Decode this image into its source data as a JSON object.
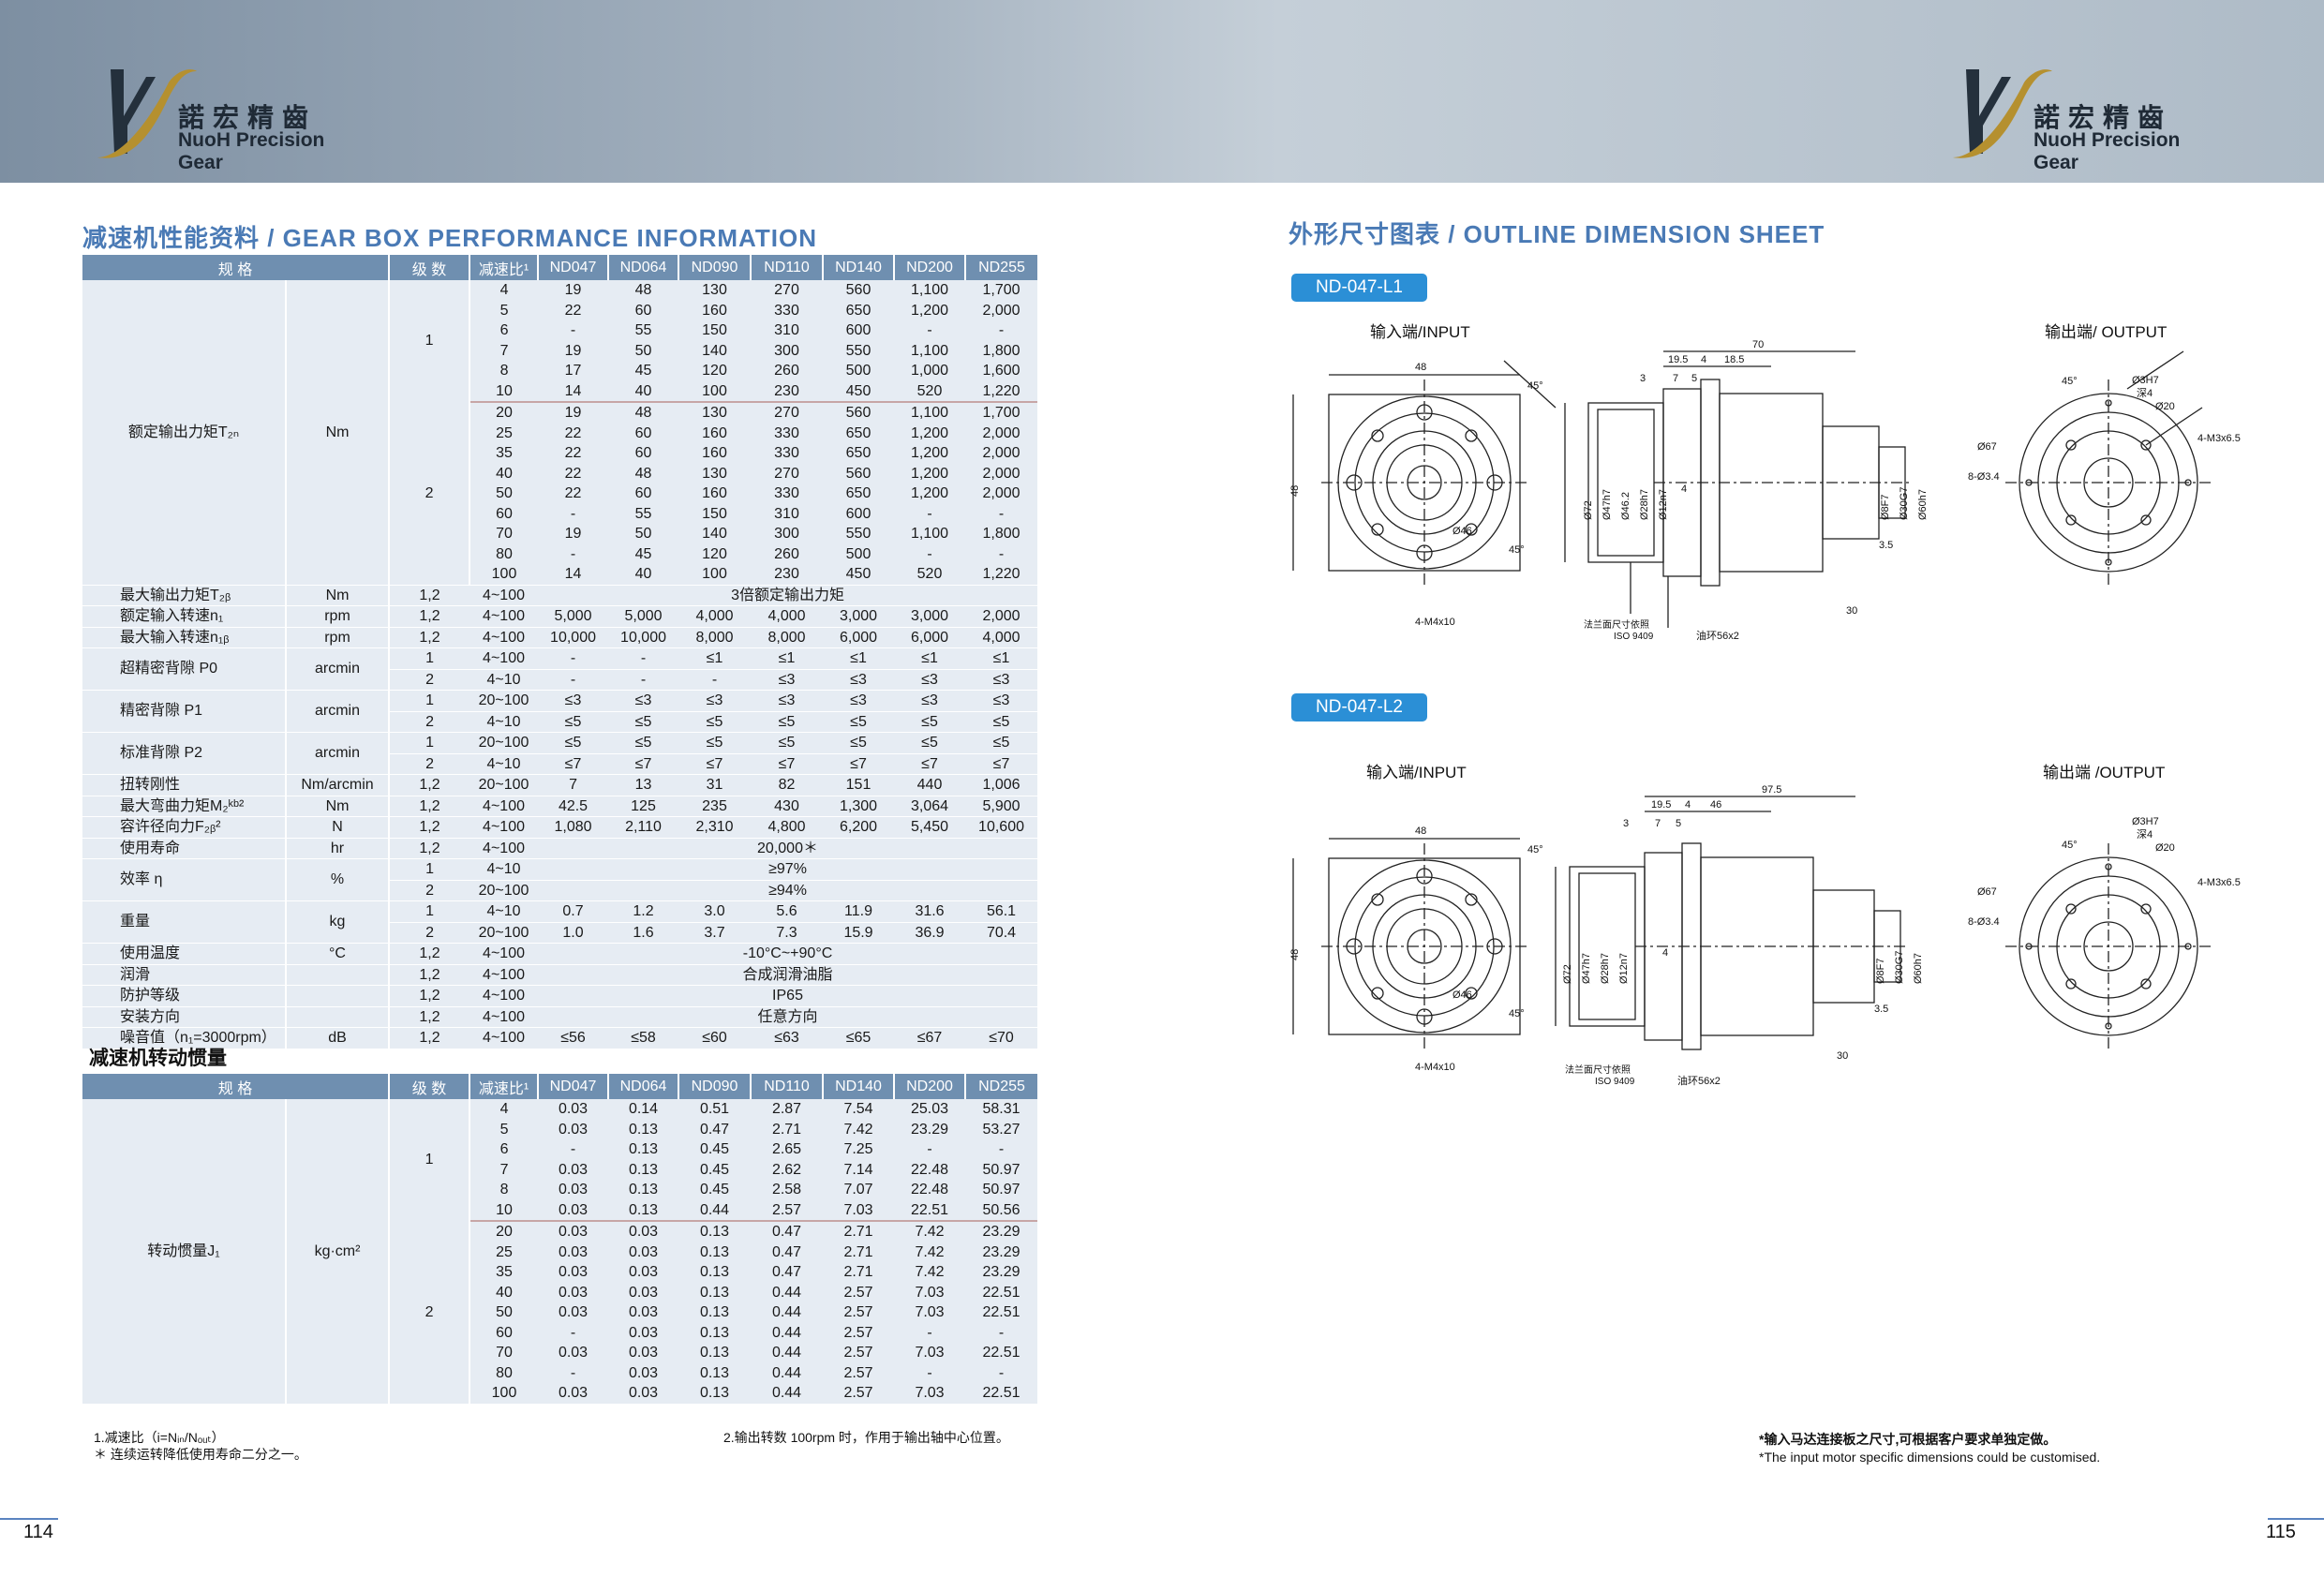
{
  "brand": {
    "cn": "諾宏精齒",
    "en": "NuoH Precision Gear"
  },
  "left": {
    "title": "减速机性能资料 / GEAR BOX PERFORMANCE INFORMATION",
    "headers": [
      "规 格",
      "级 数",
      "减速比¹",
      "ND047",
      "ND064",
      "ND090",
      "ND110",
      "ND140",
      "ND200",
      "ND255"
    ],
    "torque": {
      "label": "额定输出力矩T₂ₙ",
      "unit": "Nm",
      "stage1": {
        "stage": "1",
        "rows": [
          [
            "4",
            "19",
            "48",
            "130",
            "270",
            "560",
            "1,100",
            "1,700"
          ],
          [
            "5",
            "22",
            "60",
            "160",
            "330",
            "650",
            "1,200",
            "2,000"
          ],
          [
            "6",
            "-",
            "55",
            "150",
            "310",
            "600",
            "-",
            "-"
          ],
          [
            "7",
            "19",
            "50",
            "140",
            "300",
            "550",
            "1,100",
            "1,800"
          ],
          [
            "8",
            "17",
            "45",
            "120",
            "260",
            "500",
            "1,000",
            "1,600"
          ],
          [
            "10",
            "14",
            "40",
            "100",
            "230",
            "450",
            "520",
            "1,220"
          ]
        ]
      },
      "stage2": {
        "stage": "2",
        "rows": [
          [
            "20",
            "19",
            "48",
            "130",
            "270",
            "560",
            "1,100",
            "1,700"
          ],
          [
            "25",
            "22",
            "60",
            "160",
            "330",
            "650",
            "1,200",
            "2,000"
          ],
          [
            "35",
            "22",
            "60",
            "160",
            "330",
            "650",
            "1,200",
            "2,000"
          ],
          [
            "40",
            "22",
            "48",
            "130",
            "270",
            "560",
            "1,200",
            "2,000"
          ],
          [
            "50",
            "22",
            "60",
            "160",
            "330",
            "650",
            "1,200",
            "2,000"
          ],
          [
            "60",
            "-",
            "55",
            "150",
            "310",
            "600",
            "-",
            "-"
          ],
          [
            "70",
            "19",
            "50",
            "140",
            "300",
            "550",
            "1,100",
            "1,800"
          ],
          [
            "80",
            "-",
            "45",
            "120",
            "260",
            "500",
            "-",
            "-"
          ],
          [
            "100",
            "14",
            "40",
            "100",
            "230",
            "450",
            "520",
            "1,220"
          ]
        ]
      }
    },
    "spec_rows": [
      {
        "label": "最大输出力矩T₂ᵦ",
        "unit": "Nm",
        "stage": "1,2",
        "ratio": "4~100",
        "span": "3倍额定输出力矩"
      },
      {
        "label": "额定输入转速n₁",
        "unit": "rpm",
        "stage": "1,2",
        "ratio": "4~100",
        "values": [
          "5,000",
          "5,000",
          "4,000",
          "4,000",
          "3,000",
          "3,000",
          "2,000"
        ]
      },
      {
        "label": "最大输入转速n₁ᵦ",
        "unit": "rpm",
        "stage": "1,2",
        "ratio": "4~100",
        "values": [
          "10,000",
          "10,000",
          "8,000",
          "8,000",
          "6,000",
          "6,000",
          "4,000"
        ]
      }
    ],
    "backlash": [
      {
        "label": "超精密背隙 P0",
        "unit": "arcmin",
        "rows": [
          {
            "stage": "1",
            "ratio": "4~100",
            "values": [
              "-",
              "-",
              "≤1",
              "≤1",
              "≤1",
              "≤1",
              "≤1"
            ]
          },
          {
            "stage": "2",
            "ratio": "4~10",
            "values": [
              "-",
              "-",
              "-",
              "≤3",
              "≤3",
              "≤3",
              "≤3"
            ]
          }
        ]
      },
      {
        "label": "精密背隙 P1",
        "unit": "arcmin",
        "rows": [
          {
            "stage": "1",
            "ratio": "20~100",
            "values": [
              "≤3",
              "≤3",
              "≤3",
              "≤3",
              "≤3",
              "≤3",
              "≤3"
            ]
          },
          {
            "stage": "2",
            "ratio": "4~10",
            "values": [
              "≤5",
              "≤5",
              "≤5",
              "≤5",
              "≤5",
              "≤5",
              "≤5"
            ]
          }
        ]
      },
      {
        "label": "标准背隙 P2",
        "unit": "arcmin",
        "rows": [
          {
            "stage": "1",
            "ratio": "20~100",
            "values": [
              "≤5",
              "≤5",
              "≤5",
              "≤5",
              "≤5",
              "≤5",
              "≤5"
            ]
          },
          {
            "stage": "2",
            "ratio": "4~10",
            "values": [
              "≤7",
              "≤7",
              "≤7",
              "≤7",
              "≤7",
              "≤7",
              "≤7"
            ]
          }
        ]
      }
    ],
    "spec_rows2": [
      {
        "label": "扭转刚性",
        "unit": "Nm/arcmin",
        "stage": "1,2",
        "ratio": "20~100",
        "values": [
          "7",
          "13",
          "31",
          "82",
          "151",
          "440",
          "1,006"
        ]
      },
      {
        "label": "最大弯曲力矩M₂ᵏᵇ²",
        "unit": "Nm",
        "stage": "1,2",
        "ratio": "4~100",
        "values": [
          "42.5",
          "125",
          "235",
          "430",
          "1,300",
          "3,064",
          "5,900"
        ]
      },
      {
        "label": "容许径向力F₂ᵦ²",
        "unit": "N",
        "stage": "1,2",
        "ratio": "4~100",
        "values": [
          "1,080",
          "2,110",
          "2,310",
          "4,800",
          "6,200",
          "5,450",
          "10,600"
        ]
      },
      {
        "label": "使用寿命",
        "unit": "hr",
        "stage": "1,2",
        "ratio": "4~100",
        "span": "20,000＊"
      }
    ],
    "efficiency": {
      "label": "效率 η",
      "unit": "%",
      "rows": [
        {
          "stage": "1",
          "ratio": "4~10",
          "span": "≥97%"
        },
        {
          "stage": "2",
          "ratio": "20~100",
          "span": "≥94%"
        }
      ]
    },
    "weight": {
      "label": "重量",
      "unit": "kg",
      "rows": [
        {
          "stage": "1",
          "ratio": "4~10",
          "values": [
            "0.7",
            "1.2",
            "3.0",
            "5.6",
            "11.9",
            "31.6",
            "56.1"
          ]
        },
        {
          "stage": "2",
          "ratio": "20~100",
          "values": [
            "1.0",
            "1.6",
            "3.7",
            "7.3",
            "15.9",
            "36.9",
            "70.4"
          ]
        }
      ]
    },
    "spec_rows3": [
      {
        "label": "使用温度",
        "unit": "°C",
        "stage": "1,2",
        "ratio": "4~100",
        "span": "-10°C~+90°C"
      },
      {
        "label": "润滑",
        "unit": "",
        "stage": "1,2",
        "ratio": "4~100",
        "span": "合成润滑油脂"
      },
      {
        "label": "防护等级",
        "unit": "",
        "stage": "1,2",
        "ratio": "4~100",
        "span": "IP65"
      },
      {
        "label": "安装方向",
        "unit": "",
        "stage": "1,2",
        "ratio": "4~100",
        "span": "任意方向"
      },
      {
        "label": "噪音值（n₁=3000rpm）",
        "unit": "dB",
        "stage": "1,2",
        "ratio": "4~100",
        "values": [
          "≤56",
          "≤58",
          "≤60",
          "≤63",
          "≤65",
          "≤67",
          "≤70"
        ]
      }
    ],
    "inertia_title": "减速机转动惯量",
    "inertia": {
      "label": "转动惯量J₁",
      "unit": "kg·cm²",
      "stage1": {
        "stage": "1",
        "rows": [
          [
            "4",
            "0.03",
            "0.14",
            "0.51",
            "2.87",
            "7.54",
            "25.03",
            "58.31"
          ],
          [
            "5",
            "0.03",
            "0.13",
            "0.47",
            "2.71",
            "7.42",
            "23.29",
            "53.27"
          ],
          [
            "6",
            "-",
            "0.13",
            "0.45",
            "2.65",
            "7.25",
            "-",
            "-"
          ],
          [
            "7",
            "0.03",
            "0.13",
            "0.45",
            "2.62",
            "7.14",
            "22.48",
            "50.97"
          ],
          [
            "8",
            "0.03",
            "0.13",
            "0.45",
            "2.58",
            "7.07",
            "22.48",
            "50.97"
          ],
          [
            "10",
            "0.03",
            "0.13",
            "0.44",
            "2.57",
            "7.03",
            "22.51",
            "50.56"
          ]
        ]
      },
      "stage2": {
        "stage": "2",
        "rows": [
          [
            "20",
            "0.03",
            "0.03",
            "0.13",
            "0.47",
            "2.71",
            "7.42",
            "23.29"
          ],
          [
            "25",
            "0.03",
            "0.03",
            "0.13",
            "0.47",
            "2.71",
            "7.42",
            "23.29"
          ],
          [
            "35",
            "0.03",
            "0.03",
            "0.13",
            "0.47",
            "2.71",
            "7.42",
            "23.29"
          ],
          [
            "40",
            "0.03",
            "0.03",
            "0.13",
            "0.44",
            "2.57",
            "7.03",
            "22.51"
          ],
          [
            "50",
            "0.03",
            "0.03",
            "0.13",
            "0.44",
            "2.57",
            "7.03",
            "22.51"
          ],
          [
            "60",
            "-",
            "0.03",
            "0.13",
            "0.44",
            "2.57",
            "-",
            "-"
          ],
          [
            "70",
            "0.03",
            "0.03",
            "0.13",
            "0.44",
            "2.57",
            "7.03",
            "22.51"
          ],
          [
            "80",
            "-",
            "0.03",
            "0.13",
            "0.44",
            "2.57",
            "-",
            "-"
          ],
          [
            "100",
            "0.03",
            "0.03",
            "0.13",
            "0.44",
            "2.57",
            "7.03",
            "22.51"
          ]
        ]
      }
    },
    "foot1": "1.减速比（i=Nᵢₙ/Nₒᵤₜ）",
    "foot2": "＊ 连续运转降低使用寿命二分之一。",
    "foot3": "2.输出转数 100rpm 时，作用于输出轴中心位置。",
    "page_no": "114"
  },
  "right": {
    "title": "外形尺寸图表 / OUTLINE DIMENSION SHEET",
    "tag1": "ND-047-L1",
    "tag2": "ND-047-L2",
    "input_label": "输入端/INPUT",
    "output_label1": "输出端/ OUTPUT",
    "output_label2": "输出端 /OUTPUT",
    "dims1": {
      "d70": "70",
      "d195": "19.5",
      "d4": "4",
      "d185": "18.5",
      "d3": "3",
      "d7": "7",
      "d5": "5",
      "d48a": "48",
      "d48b": "48",
      "d72": "Ø72",
      "d47": "Ø47h7",
      "d462": "Ø46.2",
      "d28": "Ø28h7",
      "d12": "Ø12n7",
      "dd4": "4",
      "d8": "Ø8F7",
      "d30": "Ø30G7",
      "d60": "Ø60h7",
      "d35": "3.5",
      "d30b": "30",
      "m4": "4-M4x10",
      "flange1": "法兰面尺寸依照",
      "flange2": "ISO 9409",
      "oil": "油环56x2",
      "a45a": "45°",
      "a45b": "45°",
      "d46": "Ø46",
      "o3h7": "Ø3H7",
      "odeep": "深4",
      "o20": "Ø20",
      "o67": "Ø67",
      "o8": "8-Ø3.4",
      "om3": "4-M3x6.5",
      "o45": "45°"
    },
    "dims2": {
      "d975": "97.5",
      "d195": "19.5",
      "d4": "4",
      "d46": "46",
      "d3": "3",
      "d7": "7",
      "d5": "5",
      "d48a": "48",
      "d48b": "48",
      "d72": "Ø72",
      "d47": "Ø47h7",
      "d28": "Ø28h7",
      "d12": "Ø12n7",
      "dd4": "4",
      "d8": "Ø8F7",
      "d30": "Ø30G7",
      "d60": "Ø60h7",
      "d35": "3.5",
      "d30b": "30",
      "m4": "4-M4x10",
      "flange1": "法兰面尺寸依照",
      "flange2": "ISO 9409",
      "oil": "油环56x2",
      "a45a": "45°",
      "a45b": "45°",
      "d46c": "Ø46",
      "o3h7": "Ø3H7",
      "odeep": "深4",
      "o20": "Ø20",
      "o67": "Ø67",
      "o8": "8-Ø3.4",
      "om3": "4-M3x6.5",
      "o45": "45°"
    },
    "note1": "*输入马达连接板之尺寸,可根据客户要求单独定做。",
    "note2": "*The input motor specific dimensions could be customised.",
    "page_no": "115"
  }
}
